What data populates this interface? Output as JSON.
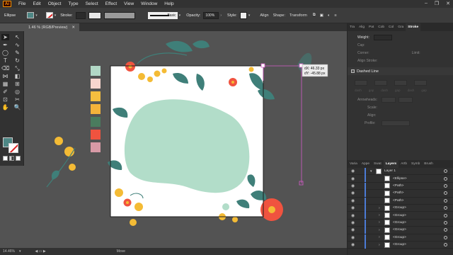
{
  "menubar": {
    "logo": "Ai",
    "items": [
      "File",
      "Edit",
      "Object",
      "Type",
      "Select",
      "Effect",
      "View",
      "Window",
      "Help"
    ]
  },
  "controlbar": {
    "selection_label": "Ellipse",
    "stroke_label": "Stroke:",
    "brush_label": "Basic",
    "opacity_label": "Opacity:",
    "opacity_value": "100%",
    "style_label": "Style:",
    "align_label": "Align",
    "shape_label": "Shape:",
    "transform_label": "Transform"
  },
  "document": {
    "tab_label": "1.46 % (RGB/Preview)",
    "zoom": "14.46%",
    "status_mode": "Move"
  },
  "tooltip": {
    "dx": "dX: 46.33 px",
    "dy": "dY: -45.88 px"
  },
  "swatches": [
    "#b2d8c6",
    "#f7d6cf",
    "#f4be3f",
    "#f4b33a",
    "#4a7c5e",
    "#f0533f",
    "#d79aa6"
  ],
  "colors": {
    "accent_fill": "#4e8785",
    "blob": "#b2ddc9",
    "leaf": "#3f7f79",
    "yellow": "#f4bb35",
    "red": "#f0533f",
    "selection": "#d55cc9",
    "layer_accent": "#4c7bd6"
  },
  "panel": {
    "tabs": [
      "Tra",
      "Alig",
      "Pat",
      "Cob",
      "Col",
      "Gra",
      "Stroke"
    ],
    "active_tab": "Stroke",
    "weight_label": "Weight:",
    "cap_label": "Cap:",
    "corner_label": "Corner:",
    "limit_label": "Limit:",
    "align_stroke_label": "Align Stroke:",
    "dashed_label": "Dashed Line",
    "dash_labels": [
      "dash",
      "gap",
      "dash",
      "gap",
      "dash",
      "gap"
    ],
    "arrowheads_label": "Arrowheads:",
    "scale_label": "Scale:",
    "align_label": "Align:",
    "profile_label": "Profile:"
  },
  "layers_panel": {
    "tabs": [
      "Varia",
      "Appe",
      "Swat",
      "Layers",
      "Artb",
      "Symb",
      "Brush"
    ],
    "active_tab": "Layers",
    "rows": [
      {
        "name": "Layer 1",
        "expanded": true
      },
      {
        "name": "<Ellipse>",
        "expanded": false
      },
      {
        "name": "<Path>",
        "expanded": false
      },
      {
        "name": "<Path>",
        "expanded": false
      },
      {
        "name": "<Path>",
        "expanded": false
      },
      {
        "name": "<Group>",
        "expanded": false
      },
      {
        "name": "<Group>",
        "expanded": false
      },
      {
        "name": "<Group>",
        "expanded": false
      },
      {
        "name": "<Group>",
        "expanded": false
      },
      {
        "name": "<Group>",
        "expanded": false
      },
      {
        "name": "<Group>",
        "expanded": false
      }
    ]
  }
}
